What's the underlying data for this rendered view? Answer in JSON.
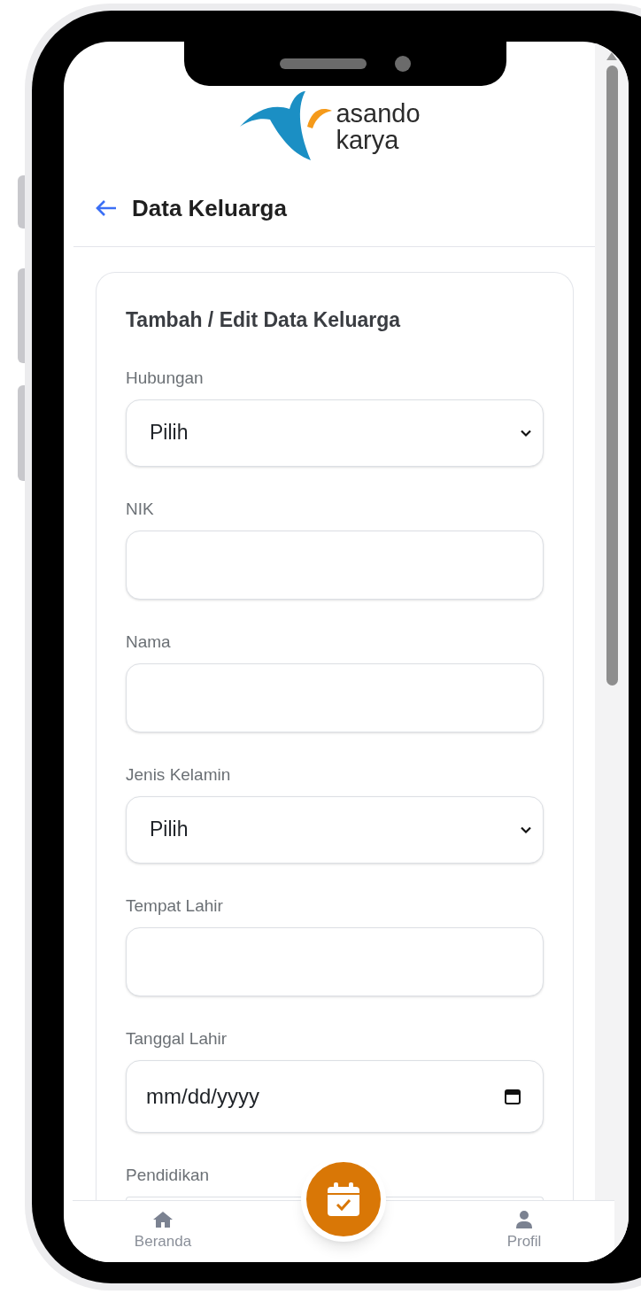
{
  "logo": {
    "lines": [
      "asando",
      "karya"
    ]
  },
  "header": {
    "title": "Data Keluarga"
  },
  "form": {
    "title": "Tambah / Edit Data Keluarga",
    "fields": [
      {
        "kind": "select",
        "label": "Hubungan",
        "value": "Pilih"
      },
      {
        "kind": "text",
        "label": "NIK"
      },
      {
        "kind": "text",
        "label": "Nama"
      },
      {
        "kind": "select",
        "label": "Jenis Kelamin",
        "value": "Pilih"
      },
      {
        "kind": "text",
        "label": "Tempat Lahir"
      },
      {
        "kind": "date",
        "label": "Tanggal Lahir",
        "placeholder": "mm/dd/yyyy"
      },
      {
        "kind": "text",
        "label": "Pendidikan"
      }
    ]
  },
  "bottom_nav": {
    "items": [
      {
        "kind": "home",
        "label": "Beranda"
      },
      {
        "kind": "fab"
      },
      {
        "kind": "profile",
        "label": "Profil"
      }
    ]
  }
}
